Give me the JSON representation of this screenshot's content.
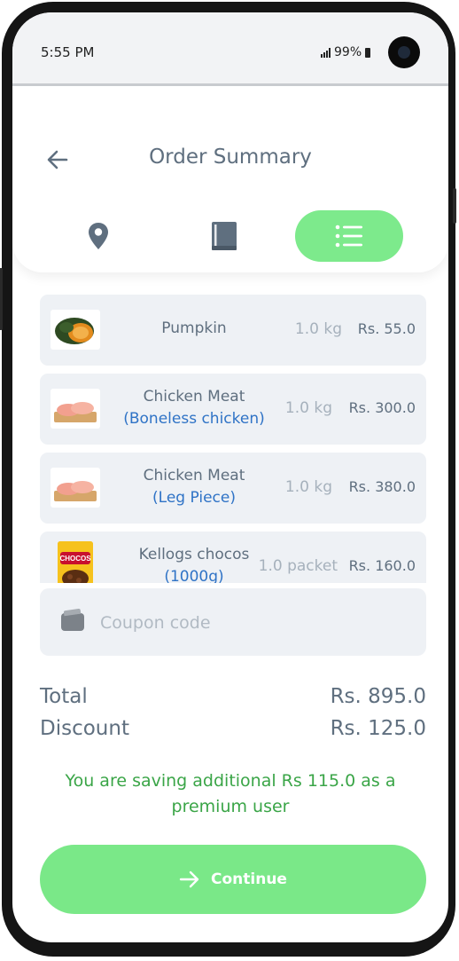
{
  "status_bar": {
    "time": "5:55 PM",
    "battery": "99%"
  },
  "header": {
    "title": "Order Summary"
  },
  "tabs": [
    {
      "icon": "location-pin-icon",
      "active": false
    },
    {
      "icon": "book-icon",
      "active": false
    },
    {
      "icon": "list-icon",
      "active": true
    }
  ],
  "items": [
    {
      "name": "Pumpkin",
      "variant": "",
      "quantity": "1.0 kg",
      "price": "Rs. 55.0"
    },
    {
      "name": "Chicken Meat",
      "variant": "(Boneless chicken)",
      "quantity": "1.0 kg",
      "price": "Rs. 300.0"
    },
    {
      "name": "Chicken Meat",
      "variant": "(Leg Piece)",
      "quantity": "1.0 kg",
      "price": "Rs. 380.0"
    },
    {
      "name": "Kellogs chocos",
      "variant": "(1000g)",
      "quantity": "1.0 packet",
      "price": "Rs. 160.0"
    }
  ],
  "coupon": {
    "placeholder": "Coupon code",
    "value": ""
  },
  "summary": {
    "total_label": "Total",
    "total_value": "Rs. 895.0",
    "discount_label": "Discount",
    "discount_value": "Rs. 125.0"
  },
  "saving_message": "You are saving additional Rs 115.0 as a premium user",
  "continue_label": "Continue",
  "colors": {
    "accent": "#7ae888",
    "text": "#5f6f7f",
    "muted": "#a6b1bc",
    "link": "#2f73c6",
    "success": "#3aa547"
  },
  "product_image_text": "CHOCOS"
}
